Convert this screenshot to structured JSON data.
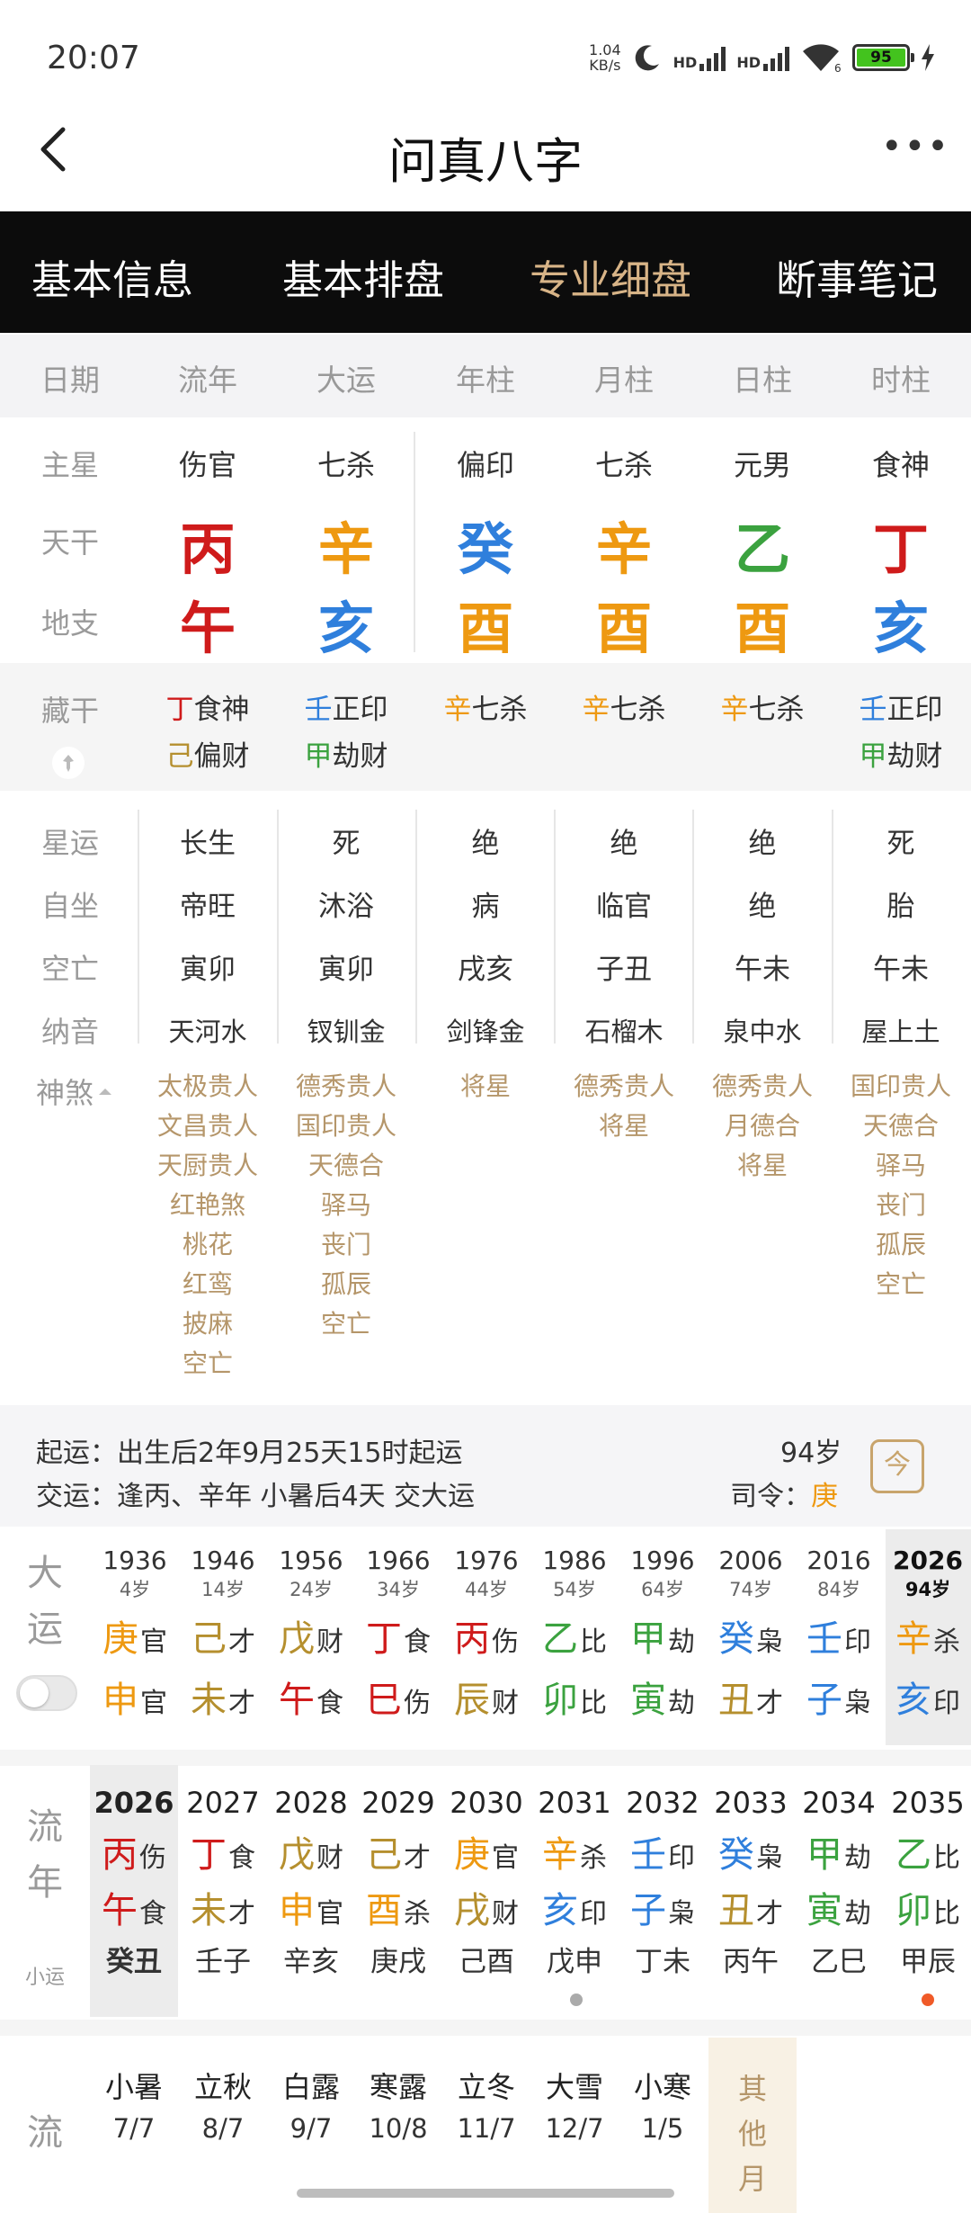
{
  "status": {
    "time": "20:07",
    "net_speed_top": "1.04",
    "net_speed_bottom": "KB/s",
    "hd1": "HD",
    "hd2": "HD",
    "wifi_badge": "6",
    "battery": "95"
  },
  "header": {
    "title": "问真八字"
  },
  "tabs": [
    {
      "label": "基本信息",
      "active": false
    },
    {
      "label": "基本排盘",
      "active": false
    },
    {
      "label": "专业细盘",
      "active": true
    },
    {
      "label": "断事笔记",
      "active": false
    }
  ],
  "columns": [
    "日期",
    "流年",
    "大运",
    "年柱",
    "月柱",
    "日柱",
    "时柱"
  ],
  "labels": {
    "zhuxing": "主星",
    "tiangan": "天干",
    "dizhi": "地支",
    "canggan": "藏干",
    "xingyun": "星运",
    "zizuo": "自坐",
    "kongwang": "空亡",
    "nayin": "纳音",
    "shensha": "神煞"
  },
  "main_stars": [
    "伤官",
    "七杀",
    "偏印",
    "七杀",
    "元男",
    "食神"
  ],
  "tiangan": [
    {
      "char": "丙",
      "color": "#cf1b1b"
    },
    {
      "char": "辛",
      "color": "#ee9911"
    },
    {
      "char": "癸",
      "color": "#2f7fdc"
    },
    {
      "char": "辛",
      "color": "#ee9911"
    },
    {
      "char": "乙",
      "color": "#3ba23f"
    },
    {
      "char": "丁",
      "color": "#cf1b1b"
    }
  ],
  "dizhi": [
    {
      "char": "午",
      "color": "#cf1b1b"
    },
    {
      "char": "亥",
      "color": "#2f7fdc"
    },
    {
      "char": "酉",
      "color": "#ee9911"
    },
    {
      "char": "酉",
      "color": "#ee9911"
    },
    {
      "char": "酉",
      "color": "#ee9911"
    },
    {
      "char": "亥",
      "color": "#2f7fdc"
    }
  ],
  "canggan": [
    [
      {
        "stem": "丁",
        "stem_color": "#cf1b1b",
        "god": "食神"
      },
      {
        "stem": "己",
        "stem_color": "#b58f2e",
        "god": "偏财"
      }
    ],
    [
      {
        "stem": "壬",
        "stem_color": "#2f7fdc",
        "god": "正印"
      },
      {
        "stem": "甲",
        "stem_color": "#3ba23f",
        "god": "劫财"
      }
    ],
    [
      {
        "stem": "辛",
        "stem_color": "#ee9911",
        "god": "七杀"
      }
    ],
    [
      {
        "stem": "辛",
        "stem_color": "#ee9911",
        "god": "七杀"
      }
    ],
    [
      {
        "stem": "辛",
        "stem_color": "#ee9911",
        "god": "七杀"
      }
    ],
    [
      {
        "stem": "壬",
        "stem_color": "#2f7fdc",
        "god": "正印"
      },
      {
        "stem": "甲",
        "stem_color": "#3ba23f",
        "god": "劫财"
      }
    ]
  ],
  "xingyun": [
    "长生",
    "死",
    "绝",
    "绝",
    "绝",
    "死"
  ],
  "zizuo": [
    "帝旺",
    "沐浴",
    "病",
    "临官",
    "绝",
    "胎"
  ],
  "kongwang": [
    "寅卯",
    "寅卯",
    "戌亥",
    "子丑",
    "午未",
    "午未"
  ],
  "nayin": [
    "天河水",
    "钗钏金",
    "剑锋金",
    "石榴木",
    "泉中水",
    "屋上土"
  ],
  "shensha": [
    [
      "太极贵人",
      "文昌贵人",
      "天厨贵人",
      "红艳煞",
      "桃花",
      "红鸾",
      "披麻",
      "空亡"
    ],
    [
      "德秀贵人",
      "国印贵人",
      "天德合",
      "驿马",
      "丧门",
      "孤辰",
      "空亡"
    ],
    [
      "将星"
    ],
    [
      "德秀贵人",
      "将星"
    ],
    [
      "德秀贵人",
      "月德合",
      "将星"
    ],
    [
      "国印贵人",
      "天德合",
      "驿马",
      "丧门",
      "孤辰",
      "空亡"
    ]
  ],
  "info": {
    "qiyun_label": "起运：",
    "qiyun_value": "出生后2年9月25天15时起运",
    "jiaoyun_label": "交运：",
    "jiaoyun_value": "逢丙、辛年 小暑后4天 交大运",
    "age": "94岁",
    "siling_label": "司令：",
    "siling_value": "庚",
    "calendar_char": "今"
  },
  "dayun": {
    "label_1": "大",
    "label_2": "运",
    "items": [
      {
        "year": "1936",
        "age": "4岁",
        "gan": "庚",
        "gan_color": "#ee9911",
        "gan_god": "官",
        "zhi": "申",
        "zhi_color": "#ee9911",
        "zhi_god": "官"
      },
      {
        "year": "1946",
        "age": "14岁",
        "gan": "己",
        "gan_color": "#b58f2e",
        "gan_god": "才",
        "zhi": "未",
        "zhi_color": "#b58f2e",
        "zhi_god": "才"
      },
      {
        "year": "1956",
        "age": "24岁",
        "gan": "戊",
        "gan_color": "#b58f2e",
        "gan_god": "财",
        "zhi": "午",
        "zhi_color": "#cf1b1b",
        "zhi_god": "食"
      },
      {
        "year": "1966",
        "age": "34岁",
        "gan": "丁",
        "gan_color": "#cf1b1b",
        "gan_god": "食",
        "zhi": "巳",
        "zhi_color": "#cf1b1b",
        "zhi_god": "伤"
      },
      {
        "year": "1976",
        "age": "44岁",
        "gan": "丙",
        "gan_color": "#cf1b1b",
        "gan_god": "伤",
        "zhi": "辰",
        "zhi_color": "#b58f2e",
        "zhi_god": "财"
      },
      {
        "year": "1986",
        "age": "54岁",
        "gan": "乙",
        "gan_color": "#3ba23f",
        "gan_god": "比",
        "zhi": "卯",
        "zhi_color": "#3ba23f",
        "zhi_god": "比"
      },
      {
        "year": "1996",
        "age": "64岁",
        "gan": "甲",
        "gan_color": "#3ba23f",
        "gan_god": "劫",
        "zhi": "寅",
        "zhi_color": "#3ba23f",
        "zhi_god": "劫"
      },
      {
        "year": "2006",
        "age": "74岁",
        "gan": "癸",
        "gan_color": "#2f7fdc",
        "gan_god": "枭",
        "zhi": "丑",
        "zhi_color": "#b58f2e",
        "zhi_god": "才"
      },
      {
        "year": "2016",
        "age": "84岁",
        "gan": "壬",
        "gan_color": "#2f7fdc",
        "gan_god": "印",
        "zhi": "子",
        "zhi_color": "#2f7fdc",
        "zhi_god": "枭"
      },
      {
        "year": "2026",
        "age": "94岁",
        "gan": "辛",
        "gan_color": "#ee9911",
        "gan_god": "杀",
        "zhi": "亥",
        "zhi_color": "#2f7fdc",
        "zhi_god": "印"
      }
    ]
  },
  "liunian": {
    "label_1": "流",
    "label_2": "年",
    "sub_label": "小运",
    "items": [
      {
        "year": "2026",
        "gan": "丙",
        "gan_color": "#cf1b1b",
        "gan_god": "伤",
        "zhi": "午",
        "zhi_color": "#cf1b1b",
        "zhi_god": "食",
        "xiaoyun": "癸丑"
      },
      {
        "year": "2027",
        "gan": "丁",
        "gan_color": "#cf1b1b",
        "gan_god": "食",
        "zhi": "未",
        "zhi_color": "#b58f2e",
        "zhi_god": "才",
        "xiaoyun": "壬子"
      },
      {
        "year": "2028",
        "gan": "戊",
        "gan_color": "#b58f2e",
        "gan_god": "财",
        "zhi": "申",
        "zhi_color": "#ee9911",
        "zhi_god": "官",
        "xiaoyun": "辛亥"
      },
      {
        "year": "2029",
        "gan": "己",
        "gan_color": "#b58f2e",
        "gan_god": "才",
        "zhi": "酉",
        "zhi_color": "#ee9911",
        "zhi_god": "杀",
        "xiaoyun": "庚戌"
      },
      {
        "year": "2030",
        "gan": "庚",
        "gan_color": "#ee9911",
        "gan_god": "官",
        "zhi": "戌",
        "zhi_color": "#b58f2e",
        "zhi_god": "财",
        "xiaoyun": "己酉"
      },
      {
        "year": "2031",
        "gan": "辛",
        "gan_color": "#ee9911",
        "gan_god": "杀",
        "zhi": "亥",
        "zhi_color": "#2f7fdc",
        "zhi_god": "印",
        "xiaoyun": "戊申"
      },
      {
        "year": "2032",
        "gan": "壬",
        "gan_color": "#2f7fdc",
        "gan_god": "印",
        "zhi": "子",
        "zhi_color": "#2f7fdc",
        "zhi_god": "枭",
        "xiaoyun": "丁未"
      },
      {
        "year": "2033",
        "gan": "癸",
        "gan_color": "#2f7fdc",
        "gan_god": "枭",
        "zhi": "丑",
        "zhi_color": "#b58f2e",
        "zhi_god": "才",
        "xiaoyun": "丙午"
      },
      {
        "year": "2034",
        "gan": "甲",
        "gan_color": "#3ba23f",
        "gan_god": "劫",
        "zhi": "寅",
        "zhi_color": "#3ba23f",
        "zhi_god": "劫",
        "xiaoyun": "乙巳"
      },
      {
        "year": "2035",
        "gan": "乙",
        "gan_color": "#3ba23f",
        "gan_god": "比",
        "zhi": "卯",
        "zhi_color": "#3ba23f",
        "zhi_god": "比",
        "xiaoyun": "甲辰"
      }
    ]
  },
  "liuyue": {
    "label_1": "流",
    "items": [
      {
        "term": "小暑",
        "date": "7/7"
      },
      {
        "term": "立秋",
        "date": "8/7"
      },
      {
        "term": "白露",
        "date": "9/7"
      },
      {
        "term": "寒露",
        "date": "10/8"
      },
      {
        "term": "立冬",
        "date": "11/7"
      },
      {
        "term": "大雪",
        "date": "12/7"
      },
      {
        "term": "小寒",
        "date": "1/5"
      }
    ],
    "other_1": "其",
    "other_2": "他",
    "other_3": "月"
  }
}
